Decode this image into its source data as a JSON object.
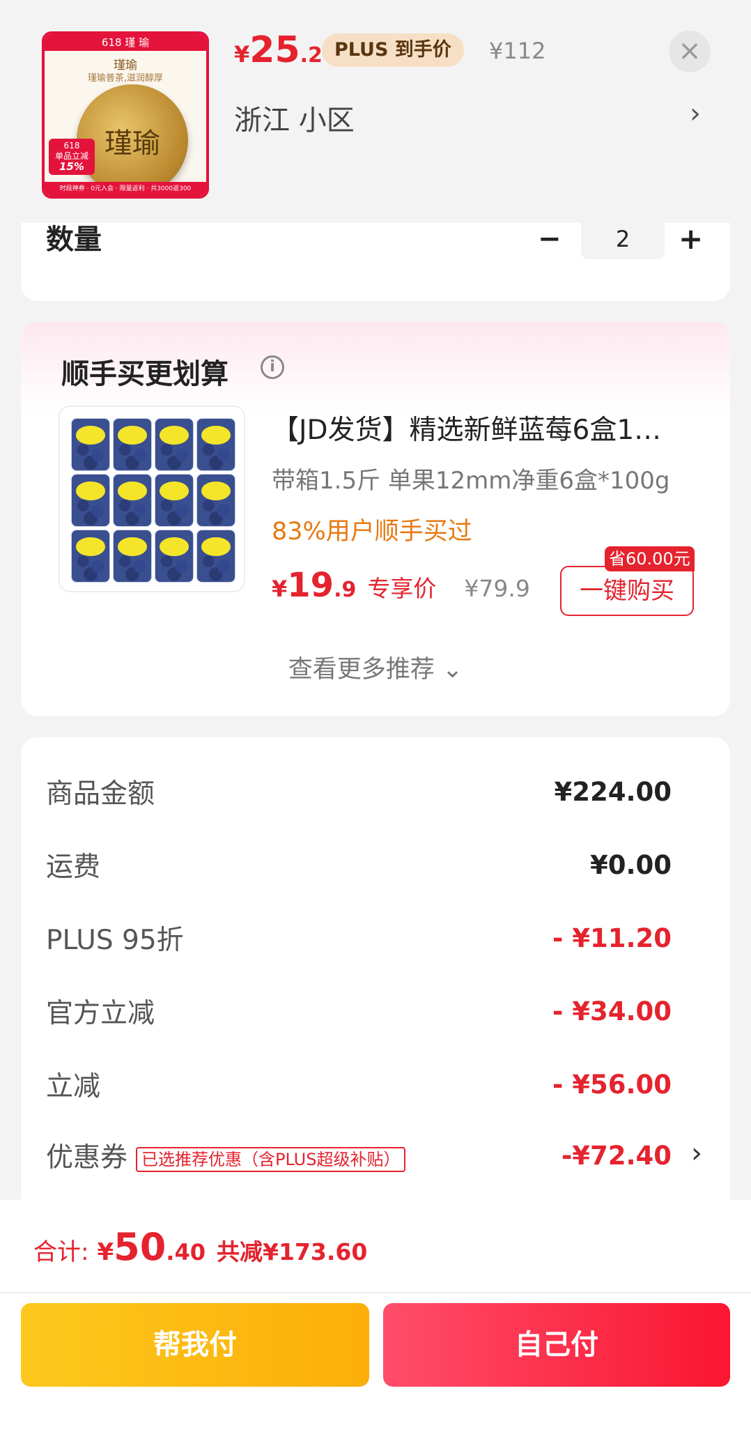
{
  "product": {
    "price_currency": "¥",
    "price_int": "25",
    "price_dec": ".2",
    "plus_tag": "PLUS 到手价",
    "original_price": "¥112",
    "address": "浙江  小区",
    "thumb": {
      "top_text": "618  瑾 瑜",
      "brand": "瑾瑜",
      "slogan": "瑾瑜普茶,滋润醇厚",
      "cake_text": "瑾瑜",
      "badge_line1": "618",
      "badge_line2": "单品立减",
      "badge_line3": "15%",
      "foot_text": "时段神券 · 0元入会 · 限量返利 · 共3000返300"
    }
  },
  "quantity": {
    "label": "数量",
    "minus": "−",
    "value": "2",
    "plus": "+"
  },
  "recommend": {
    "title": "顺手买更划算",
    "item_name": "【JD发货】精选新鲜蓝莓6盒1…",
    "item_spec": "带箱1.5斤 单果12mm净重6盒*100g",
    "bought_text": "83%用户顺手买过",
    "price_currency": "¥",
    "price_int": "19",
    "price_dec": ".9",
    "price_tag": "专享价",
    "original_price": "¥79.9",
    "save_badge": "省60.00元",
    "buy_button": "一键购买",
    "more_link": "查看更多推荐 ⌄"
  },
  "summary": {
    "rows": [
      {
        "label": "商品金额",
        "value": "¥224.00"
      },
      {
        "label": "运费",
        "value": "¥0.00"
      },
      {
        "label": "PLUS 95折",
        "value": "- ¥11.20"
      },
      {
        "label": "官方立减",
        "value": "- ¥34.00"
      },
      {
        "label": "立减",
        "value": "- ¥56.00"
      }
    ],
    "coupon": {
      "label": "优惠券",
      "tag": "已选推荐优惠（含PLUS超级补贴）",
      "value": "-¥72.40"
    }
  },
  "footer": {
    "total_label": "合计:",
    "total_currency": "¥",
    "total_int": "50",
    "total_dec": ".40",
    "saved_text": "共减¥173.60",
    "help_pay_button": "帮我付",
    "self_pay_button": "自己付"
  },
  "colors": {
    "accent_red": "#e4232e",
    "plus_gold": "#f6dfc4",
    "help_button": "#fdc81d",
    "self_button": "#fa1630"
  }
}
